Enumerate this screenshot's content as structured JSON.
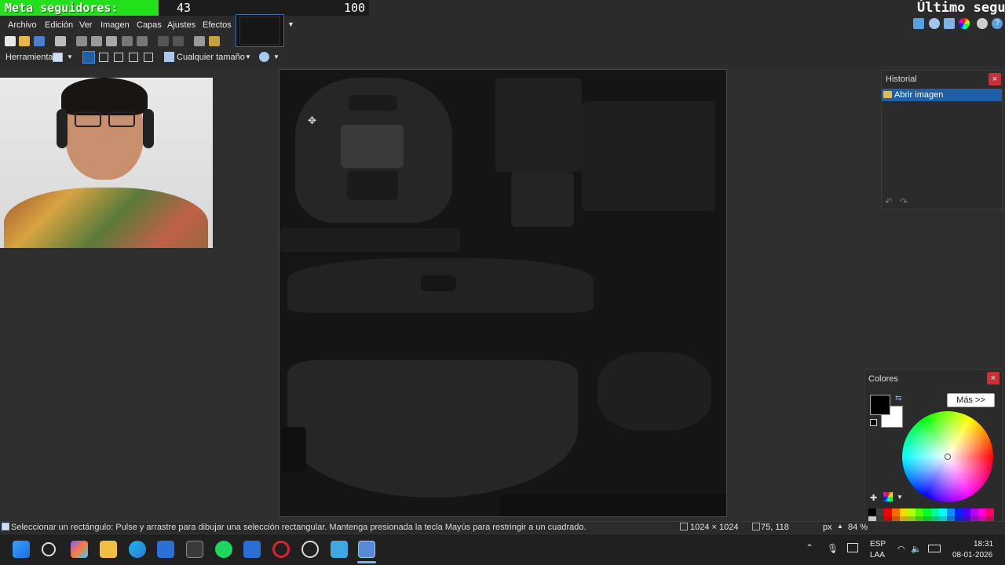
{
  "overlay": {
    "goal_label": "Meta seguidores:",
    "goal_current": "43",
    "goal_target": "100",
    "goal_progress": 0.43,
    "last_follower_label": "Último segui"
  },
  "menu": {
    "items": [
      "Archivo",
      "Edición",
      "Ver",
      "Imagen",
      "Capas",
      "Ajustes",
      "Efectos"
    ]
  },
  "toolbar": {
    "tool_label": "Herramienta:",
    "size_select": "Cualquier tamaño"
  },
  "history_panel": {
    "title": "Historial",
    "close": "×",
    "items": [
      "Abrir imagen"
    ]
  },
  "colors_panel": {
    "title": "Colores",
    "close": "×",
    "more_button": "Más >>",
    "primary_color": "#000000",
    "secondary_color": "#ffffff",
    "palette": [
      "#000000",
      "#404040",
      "#ff0000",
      "#ff6a00",
      "#ffd800",
      "#b6ff00",
      "#4cff00",
      "#00ff21",
      "#00ff90",
      "#00ffff",
      "#0094ff",
      "#0026ff",
      "#4800ff",
      "#b200ff",
      "#ff00dc",
      "#ff006e"
    ]
  },
  "status": {
    "hint": "Seleccionar un rectángulo: Pulse y arrastre para dibujar una selección rectangular. Mantenga presionada la tecla Mayús para restringir a un cuadrado.",
    "image_size": "1024 × 1024",
    "cursor_pos": "75, 118",
    "unit": "px",
    "zoom": "84 %"
  },
  "taskbar": {
    "lang": "ESP",
    "lang_sub": "LAA",
    "time": "18:31",
    "date": "08-01-2026"
  },
  "colors": {
    "selection_blue": "#1f5fa8",
    "goal_green": "#22e01a",
    "close_red": "#c7303a"
  }
}
